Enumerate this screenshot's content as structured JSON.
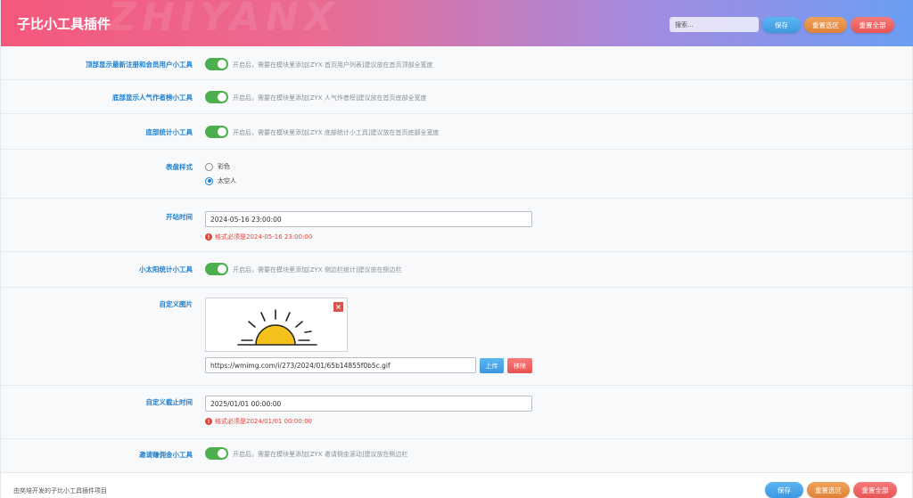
{
  "header": {
    "title": "子比小工具插件",
    "watermark": "ZHIYANX",
    "search_placeholder": "搜索...",
    "save": "保存",
    "reset_section": "重置选区",
    "reset_all": "重置全部"
  },
  "settings": {
    "top_new_users": {
      "label": "顶部显示最新注册和会员用户小工具",
      "enabled": true,
      "desc": "开启后，需要在模块里添加[ZYX 首页用户列表]建议放在首页顶部全宽度"
    },
    "popular_authors": {
      "label": "底部显示人气作者榜小工具",
      "enabled": true,
      "desc": "开启后，需要在模块里添加[ZYX 人气作者榜]建议放在首页底部全宽度"
    },
    "bottom_stats": {
      "label": "底部统计小工具",
      "enabled": true,
      "desc": "开启后，需要在模块里添加[ZYX 底部统计小工具]建议放在首页底部全宽度"
    },
    "dial_style": {
      "label": "表盘样式",
      "options": [
        "彩色",
        "太空人"
      ],
      "selected": "太空人"
    },
    "start_time": {
      "label": "开站时间",
      "value": "2024-05-16 23:00:00",
      "error": "格式必须是2024-05-16 23:00:00"
    },
    "sun_stats": {
      "label": "小太阳统计小工具",
      "enabled": true,
      "desc": "开启后，需要在模块里添加[ZYX 侧边栏统计]建议放在侧边栏"
    },
    "custom_image": {
      "label": "自定义图片",
      "url": "https://wmimg.com/i/273/2024/01/65b14855f0b5c.gif",
      "upload": "上传",
      "remove": "移除",
      "close_glyph": "×"
    },
    "custom_deadline": {
      "label": "自定义截止时间",
      "value": "2025/01/01 00:00:00",
      "error": "格式必须是2024/01/01 00:00:00"
    },
    "invite_commission": {
      "label": "邀请赚佣金小工具",
      "enabled": true,
      "desc": "开启后，需要在模块里添加[ZYX 邀请佣金滚动]建议放在侧边栏"
    }
  },
  "footer": {
    "credit": "由奕培开发的子比小工具插件项目",
    "save": "保存",
    "reset_section": "重置选区",
    "reset_all": "重置全部"
  },
  "colors": {
    "accent": "#1e7fd0",
    "toggle_on": "#4cae4c",
    "error": "#e0453a",
    "sun": "#f5c21b"
  },
  "icons": {
    "error": "exclamation-circle-icon",
    "close": "close-icon"
  }
}
